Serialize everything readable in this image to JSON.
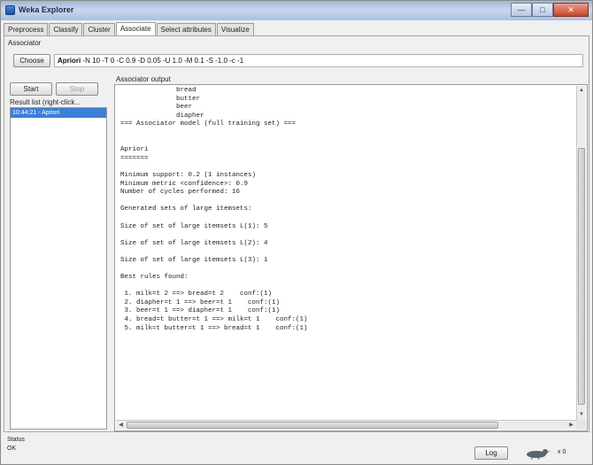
{
  "window": {
    "title": "Weka Explorer",
    "buttons": [
      "—",
      "□",
      "✕"
    ]
  },
  "tabs": [
    "Preprocess",
    "Classify",
    "Cluster",
    "Associate",
    "Select attributes",
    "Visualize"
  ],
  "active_tab_index": 3,
  "associator": {
    "section_label": "Associator",
    "choose_label": "Choose",
    "scheme_name": "Apriori",
    "scheme_options": "-N 10 -T 0 -C 0.9 -D 0.05 -U 1.0 -M 0.1 -S -1.0 -c -1"
  },
  "controls": {
    "start_label": "Start",
    "stop_label": "Stop"
  },
  "result_list": {
    "label": "Result list (right-click...",
    "items": [
      "10:44:21 - Apriori"
    ]
  },
  "output": {
    "label": "Associator output",
    "lines": [
      "              bread",
      "              butter",
      "              beer",
      "              diapher",
      "=== Associator model (full training set) ===",
      "",
      "",
      "Apriori",
      "=======",
      "",
      "Minimum support: 0.2 (1 instances)",
      "Minimum metric <confidence>: 0.9",
      "Number of cycles performed: 16",
      "",
      "Generated sets of large itemsets:",
      "",
      "Size of set of large itemsets L(1): 5",
      "",
      "Size of set of large itemsets L(2): 4",
      "",
      "Size of set of large itemsets L(3): 1",
      "",
      "Best rules found:",
      "",
      " 1. milk=t 2 ==> bread=t 2    conf:(1)",
      " 2. diapher=t 1 ==> beer=t 1    conf:(1)",
      " 3. beer=t 1 ==> diapher=t 1    conf:(1)",
      " 4. bread=t butter=t 1 ==> milk=t 1    conf:(1)",
      " 5. milk=t butter=t 1 ==> bread=t 1    conf:(1)"
    ]
  },
  "status": {
    "label": "Status",
    "text": "OK",
    "log_label": "Log",
    "count_text": "x 0"
  }
}
